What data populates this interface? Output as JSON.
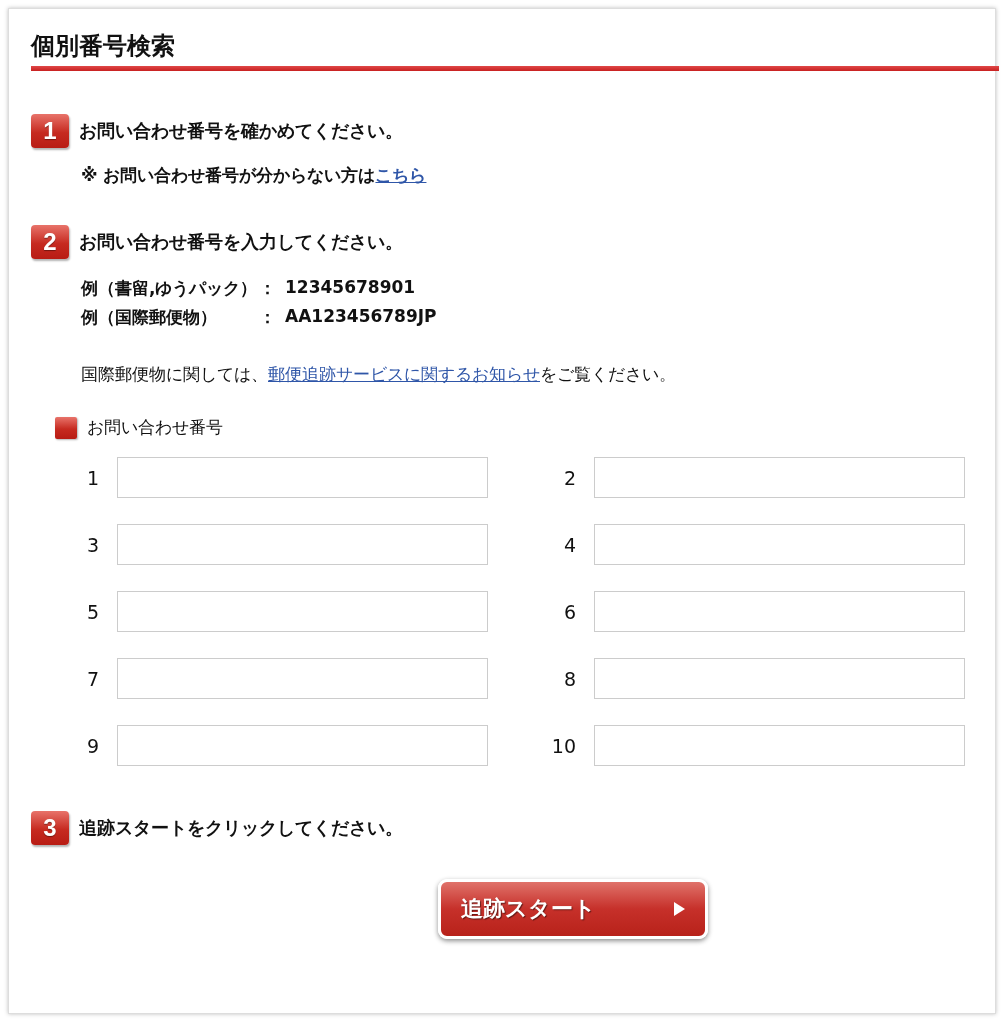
{
  "title": "個別番号検索",
  "step1": {
    "number": "1",
    "heading": "お問い合わせ番号を確かめてください。",
    "note_prefix": "※ お問い合わせ番号が分からない方は",
    "note_link": "こちら"
  },
  "step2": {
    "number": "2",
    "heading": "お問い合わせ番号を入力してください。",
    "examples": [
      {
        "label": "例（書留,ゆうパック）",
        "separator": "：",
        "value": "12345678901"
      },
      {
        "label": "例（国際郵便物）",
        "separator": "：",
        "value": "AA123456789JP"
      }
    ],
    "notice_before": "国際郵便物に関しては、",
    "notice_link": "郵便追跡サービスに関するお知らせ",
    "notice_after": "をご覧ください。",
    "field_group_label": "お問い合わせ番号",
    "fields": [
      {
        "label": "1"
      },
      {
        "label": "2"
      },
      {
        "label": "3"
      },
      {
        "label": "4"
      },
      {
        "label": "5"
      },
      {
        "label": "6"
      },
      {
        "label": "7"
      },
      {
        "label": "8"
      },
      {
        "label": "9"
      },
      {
        "label": "10"
      }
    ]
  },
  "step3": {
    "number": "3",
    "heading": "追跡スタートをクリックしてください。",
    "button": "追跡スタート"
  }
}
